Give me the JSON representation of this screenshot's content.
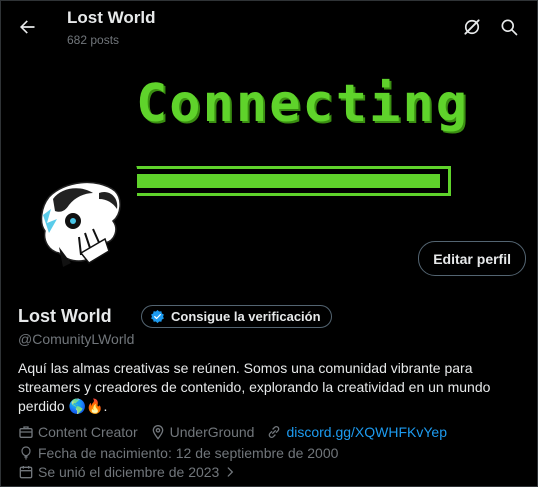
{
  "header": {
    "title": "Lost World",
    "posts": "682 posts"
  },
  "banner": {
    "text": "Connecting",
    "progress": 0.99
  },
  "profile": {
    "name": "Lost World",
    "verify_label": "Consigue la verificación",
    "handle": "@ComunityLWorld",
    "edit_label": "Editar perfil",
    "bio": "Aquí las almas creativas se reúnen. Somos una comunidad vibrante para streamers y creadores de contenido, explorando la creatividad en un mundo perdido 🌎🔥.",
    "category": "Content Creator",
    "location": "UnderGround",
    "link": "discord.gg/XQWHFKvYep",
    "birthdate": "Fecha de nacimiento: 12 de septiembre de 2000",
    "joined": "Se unió el diciembre de 2023"
  },
  "colors": {
    "accent": "#1d9bf0",
    "banner_green": "#5fd32b",
    "muted": "#71767b"
  },
  "icons": [
    "back-arrow-icon",
    "grok-icon",
    "search-icon",
    "verified-badge-icon",
    "briefcase-icon",
    "location-pin-icon",
    "link-icon",
    "balloon-icon",
    "calendar-icon",
    "chevron-right-icon"
  ]
}
